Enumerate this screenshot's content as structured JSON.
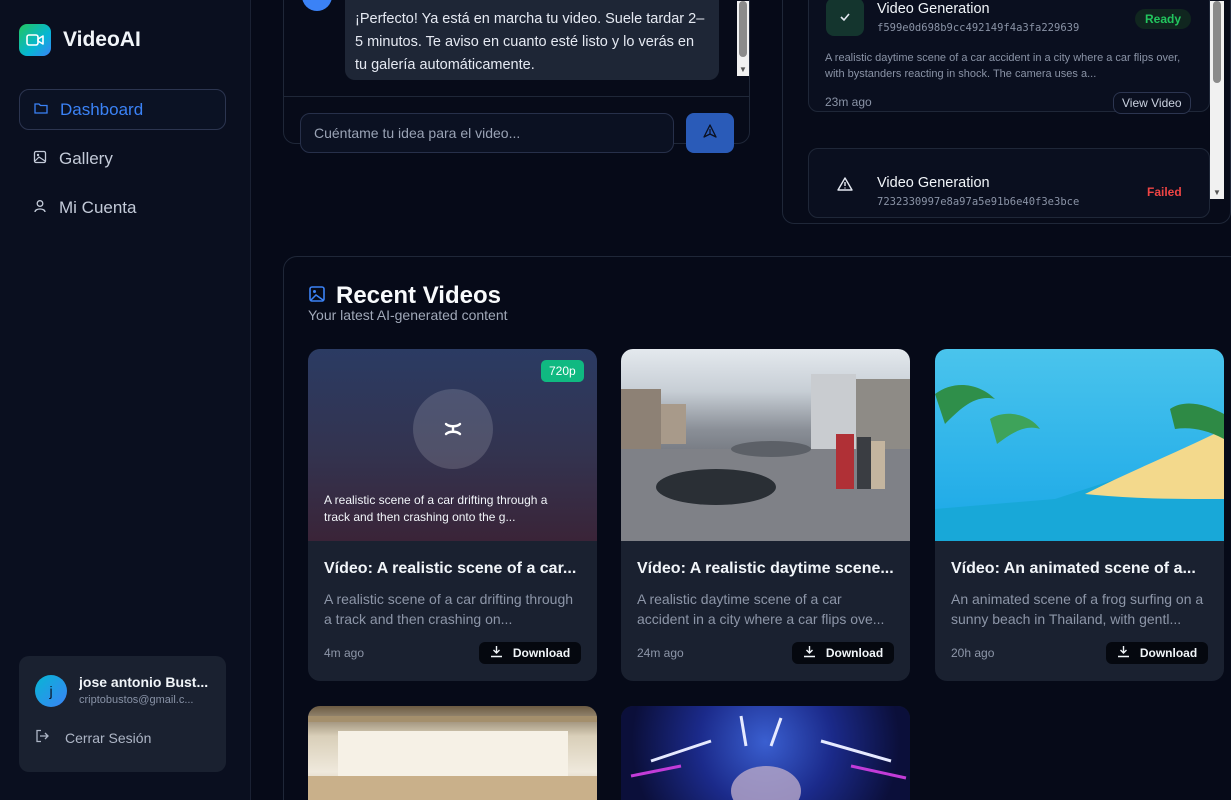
{
  "app": {
    "name": "VideoAI"
  },
  "nav": {
    "items": [
      {
        "label": "Dashboard",
        "icon": "folder-icon",
        "active": true
      },
      {
        "label": "Gallery",
        "icon": "image-icon",
        "active": false
      },
      {
        "label": "Mi Cuenta",
        "icon": "user-icon",
        "active": false
      }
    ]
  },
  "user": {
    "name": "jose antonio Bust...",
    "email": "criptobustos@gmail.c...",
    "avatar_initial": "j",
    "logout_label": "Cerrar Sesión"
  },
  "chat": {
    "message": "¡Perfecto! Ya está en marcha tu video. Suele tardar 2–5 minutos. Te aviso en cuanto esté listo y lo verás en tu galería automáticamente.",
    "input_placeholder": "Cuéntame tu idea para el video..."
  },
  "generations": [
    {
      "title": "Video Generation",
      "id": "f599e0d698b9cc492149f4a3fa229639",
      "status": "Ready",
      "description": "A realistic daytime scene of a car accident in a city where a car flips over, with bystanders reacting in shock. The camera uses a...",
      "time": "23m ago",
      "action_label": "View Video"
    },
    {
      "title": "Video Generation",
      "id": "7232330997e8a97a5e91b6e40f3e3bce",
      "status": "Failed"
    }
  ],
  "recent": {
    "title": "Recent Videos",
    "subtitle": "Your latest AI-generated content",
    "download_label": "Download",
    "videos": [
      {
        "title": "Vídeo: A realistic scene of a car...",
        "description": "A realistic scene of a car drifting through a track and then crashing on...",
        "thumb_caption": "A realistic scene of a car drifting through a track and then crashing onto the g...",
        "badge": "720p",
        "time": "4m ago"
      },
      {
        "title": "Vídeo: A realistic daytime scene...",
        "description": "A realistic daytime scene of a car accident in a city where a car flips ove...",
        "time": "24m ago"
      },
      {
        "title": "Vídeo: An animated scene of a...",
        "description": "An animated scene of a frog surfing on a sunny beach in Thailand, with gentl...",
        "time": "20h ago"
      }
    ]
  },
  "colors": {
    "accent": "#3b82f6",
    "ready": "#22c55e",
    "failed": "#ef4444",
    "badge": "#10b981"
  }
}
